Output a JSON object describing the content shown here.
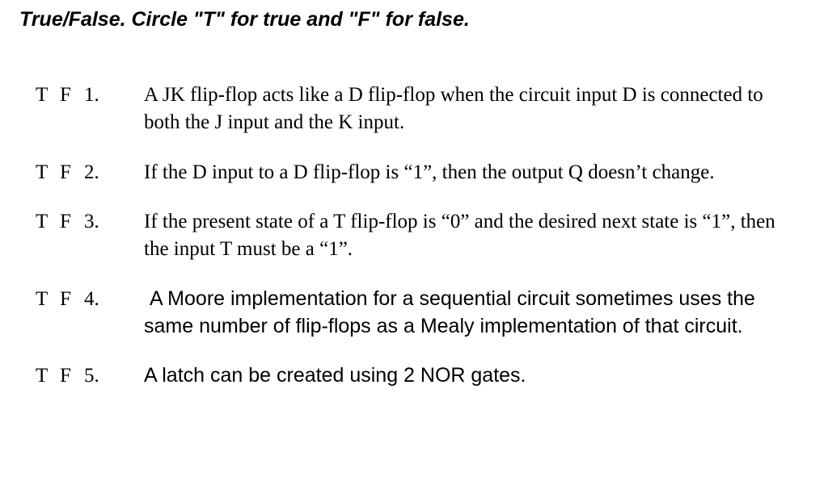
{
  "instructions": "True/False. Circle \"T\" for true and \"F\" for false.",
  "tf": {
    "true_label": "T",
    "false_label": "F"
  },
  "questions": [
    {
      "number": "1.",
      "text": "A JK flip-flop acts like a D flip-flop when the circuit input D is connected to both the J input and the K input."
    },
    {
      "number": "2.",
      "text": "If the D input to a D flip-flop is “1”, then the output Q doesn’t change."
    },
    {
      "number": "3.",
      "text": "If the present state of a T flip-flop is “0” and the desired next state is “1”, then the input T must be a “1”."
    },
    {
      "number": "4.",
      "text": " A Moore implementation for a sequential circuit sometimes uses the same number of flip-flops as a Mealy implementation of that circuit."
    },
    {
      "number": "5.",
      "text": "A latch can be created using 2 NOR gates."
    }
  ]
}
